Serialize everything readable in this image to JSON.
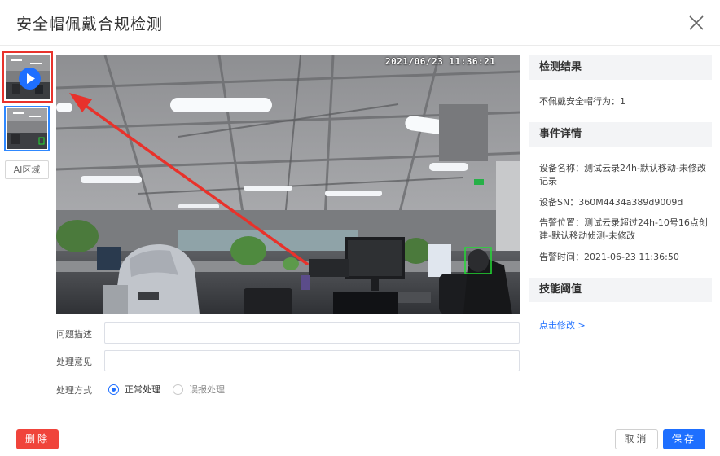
{
  "dialog": {
    "title": "安全帽佩戴合规检测"
  },
  "media": {
    "timestamp": "2021/06/23 11:36:21",
    "ai_region_label": "AI区域"
  },
  "form": {
    "problem_label": "问题描述",
    "problem_value": "",
    "opinion_label": "处理意见",
    "opinion_value": "",
    "method_label": "处理方式",
    "options": [
      {
        "label": "正常处理",
        "selected": true
      },
      {
        "label": "误报处理",
        "selected": false
      }
    ]
  },
  "result": {
    "heading": "检测结果",
    "text": "不佩戴安全帽行为：1"
  },
  "details": {
    "heading": "事件详情",
    "device_name": "设备名称：测试云录24h-默认移动-未修改记录",
    "device_sn": "设备SN：360M4434a389d9009d",
    "alarm_location": "告警位置：测试云录超过24h-10号16点创建-默认移动侦测-未修改",
    "alarm_time": "告警时间：2021-06-23 11:36:50"
  },
  "threshold": {
    "heading": "技能阈值",
    "link": "点击修改 >"
  },
  "footer": {
    "delete_label": "删除",
    "cancel_label": "取消",
    "save_label": "保存"
  },
  "colors": {
    "primary": "#1e6fff",
    "danger": "#f0443b",
    "highlight": "#e8322b",
    "detection_box": "#22dd33"
  }
}
